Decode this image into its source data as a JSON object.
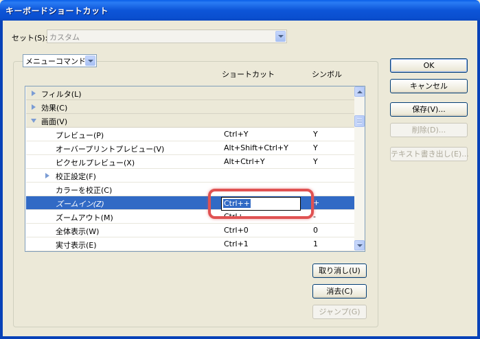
{
  "window": {
    "title": "キーボードショートカット"
  },
  "set": {
    "label": "セット(S):",
    "value": "カスタム"
  },
  "category": {
    "value": "メニューコマンド"
  },
  "columns": {
    "shortcut": "ショートカット",
    "symbol": "シンボル"
  },
  "buttons": {
    "ok": "OK",
    "cancel": "キャンセル",
    "save": "保存(V)...",
    "delete": "削除(D)...",
    "export": "テキスト書き出し(E)...",
    "undo": "取り消し(U)",
    "clear": "消去(C)",
    "jump": "ジャンプ(G)"
  },
  "rows": [
    {
      "label": "フィルタ(L)",
      "type": "header",
      "expander": "collapsed"
    },
    {
      "label": "効果(C)",
      "type": "header",
      "expander": "collapsed"
    },
    {
      "label": "画面(V)",
      "type": "header",
      "expander": "expanded"
    },
    {
      "label": "プレビュー(P)",
      "shortcut": "Ctrl+Y",
      "symbol": "Y"
    },
    {
      "label": "オーバープリントプレビュー(V)",
      "shortcut": "Alt+Shift+Ctrl+Y",
      "symbol": "Y"
    },
    {
      "label": "ピクセルプレビュー(X)",
      "shortcut": "Alt+Ctrl+Y",
      "symbol": "Y"
    },
    {
      "label": "校正設定(F)",
      "expander": "collapsed"
    },
    {
      "label": "カラーを校正(C)"
    },
    {
      "label": "ズームイン(Z)",
      "shortcut": "Ctrl++",
      "symbol": "+",
      "selected": true
    },
    {
      "label": "ズームアウト(M)",
      "shortcut": "Ctrl+-",
      "symbol": "-"
    },
    {
      "label": "全体表示(W)",
      "shortcut": "Ctrl+0",
      "symbol": "0"
    },
    {
      "label": "実寸表示(E)",
      "shortcut": "Ctrl+1",
      "symbol": "1"
    }
  ],
  "editing": {
    "value": "Ctrl++"
  }
}
